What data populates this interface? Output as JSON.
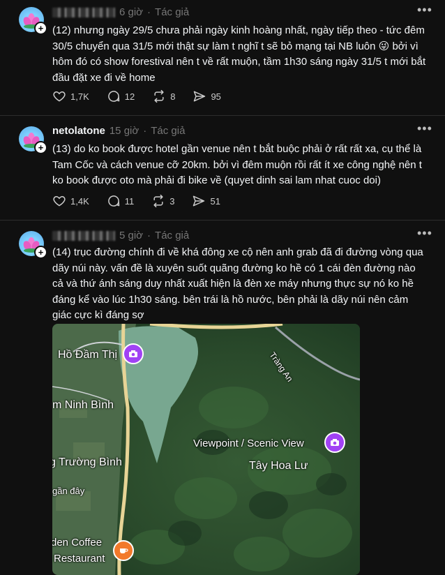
{
  "posts": [
    {
      "username": "",
      "time": "6 giờ",
      "separator": "·",
      "author_tag": "Tác giả",
      "text": "(12) nhưng ngày 29/5 chưa phải ngày kinh hoàng nhất, ngày tiếp theo - tức đêm 30/5 chuyển qua 31/5 mới thật sự làm t nghĩ t sẽ bỏ mạng tại NB luôn 😜 bởi vì hôm đó có show forestival nên t về rất muộn, tầm 1h30 sáng ngày 31/5 t mới bắt đầu đặt xe đi về home",
      "likes": "1,7K",
      "comments": "12",
      "reposts": "8",
      "shares": "95"
    },
    {
      "username": "netolatone",
      "time": "15 giờ",
      "separator": "·",
      "author_tag": "Tác giả",
      "text": "(13) do ko book được hotel gần venue nên t bắt buộc phải ở rất rất xa, cụ thể là Tam Cốc và cách venue cỡ 20km. bởi vì đêm muộn rồi rất ít xe công nghệ nên t ko book được oto mà phải đi bike về (quyet dinh sai lam nhat cuoc doi)",
      "likes": "1,4K",
      "comments": "11",
      "reposts": "3",
      "shares": "51"
    },
    {
      "username": "",
      "time": "5 giờ",
      "separator": "·",
      "author_tag": "Tác giả",
      "text": "(14) trục đường chính đi về khá đông xe cộ nên anh grab đã đi đường vòng qua dãy núi này. vấn đề là xuyên suốt quãng đường ko hề có 1 cái đèn đường nào cả và thứ ánh sáng duy nhất xuất hiện là đèn xe máy nhưng thực sự nó ko hề đáng kể vào lúc 1h30 sáng. bên trái là hồ nước, bên phải là dãy núi nên cảm giác cực kì đáng sợ"
    }
  ],
  "map": {
    "labels": {
      "lake": "Hồ Đầm Thị",
      "ninh_binh": "m Ninh Bình",
      "truong_binh": "g Trường Bình",
      "gan_day": "gần đây",
      "viewpoint": "Viewpoint / Scenic View",
      "tay_hoa_lu": "Tây Hoa Lư",
      "trang_an": "Tràng An",
      "coffee1": "den Coffee",
      "coffee2": "Restaurant"
    }
  },
  "icons": {
    "more": "more-horizontal-icon",
    "like": "heart-icon",
    "comment": "comment-icon",
    "repost": "repost-icon",
    "share": "share-icon"
  },
  "colors": {
    "background": "#101010",
    "text": "#f3f5f7",
    "muted": "#777777",
    "pin_purple": "#a142f4",
    "pin_orange": "#f2792b"
  }
}
